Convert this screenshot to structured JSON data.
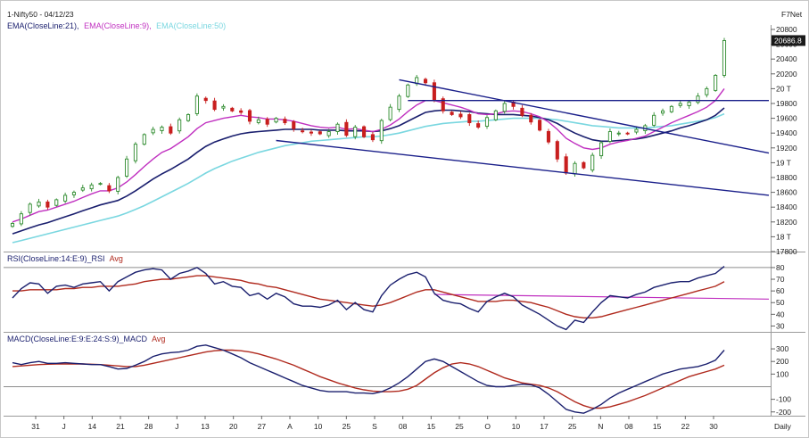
{
  "header": {
    "title": "1-Nifty50 - 04/12/23",
    "corner_label": "F7Net",
    "ema_legend": [
      {
        "text": "EMA(CloseLine:21),",
        "color": "#1a1f6e"
      },
      {
        "text": "EMA(CloseLine:9),",
        "color": "#c030c0"
      },
      {
        "text": "EMA(CloseLine:50)",
        "color": "#7ad7e0"
      }
    ]
  },
  "panels": {
    "rsi_title": "RSI(CloseLine:14:E:9)_RSI",
    "rsi_avg": "Avg",
    "macd_title": "MACD(CloseLine:E:9:E:24:S:9)_MACD",
    "macd_avg": "Avg",
    "footer_right": "Daily"
  },
  "colors": {
    "bull": "#2e8b2e",
    "bear": "#c81e1e",
    "ema9": "#c030c0",
    "ema21": "#1a1f6e",
    "ema50": "#7ad7e0",
    "trend": "#1a1f8a",
    "rsi_line": "#1a1f6e",
    "rsi_avg": "#b02a1e",
    "macd_line": "#1a1f6e",
    "macd_avg": "#b02a1e",
    "rsi_resist": "#c030c0"
  },
  "chart_data": [
    {
      "type": "candlestick",
      "title": "1-Nifty50 - 04/12/23",
      "series_names": [
        "EMA(CloseLine:21)",
        "EMA(CloseLine:9)",
        "EMA(CloseLine:50)"
      ],
      "y_ticks": [
        "20800",
        "20600",
        "20400",
        "20200",
        "20 T",
        "19800",
        "19600",
        "19400",
        "19200",
        "19 T",
        "18800",
        "18600",
        "18400",
        "18200",
        "18 T",
        "17800"
      ],
      "y_tick_values": [
        20800,
        20600,
        20400,
        20200,
        20000,
        19800,
        19600,
        19400,
        19200,
        19000,
        18800,
        18600,
        18400,
        18200,
        18000,
        17800
      ],
      "ylim": [
        17800,
        20800
      ],
      "last_price_label": "20686.8",
      "x_ticks": [
        "31",
        "J",
        "14",
        "21",
        "28",
        "J",
        "13",
        "20",
        "27",
        "A",
        "10",
        "25",
        "S",
        "08",
        "15",
        "25",
        "O",
        "10",
        "17",
        "25",
        "N",
        "08",
        "15",
        "22",
        "30"
      ],
      "close": [
        18180,
        18310,
        18440,
        18470,
        18400,
        18500,
        18560,
        18600,
        18660,
        18700,
        18720,
        18620,
        18800,
        19050,
        19250,
        19380,
        19450,
        19480,
        19400,
        19580,
        19650,
        19900,
        19840,
        19720,
        19760,
        19700,
        19680,
        19560,
        19580,
        19520,
        19600,
        19540,
        19460,
        19420,
        19400,
        19390,
        19420,
        19520,
        19370,
        19480,
        19350,
        19310,
        19570,
        19750,
        19900,
        20050,
        20150,
        20080,
        19840,
        19700,
        19650,
        19620,
        19540,
        19480,
        19610,
        19700,
        19800,
        19760,
        19640,
        19550,
        19440,
        19280,
        19050,
        18860,
        18990,
        18930,
        19100,
        19270,
        19420,
        19400,
        19390,
        19450,
        19500,
        19640,
        19700,
        19760,
        19800,
        19820,
        19900,
        20000,
        20180,
        20650
      ],
      "ema9": [
        18200,
        18240,
        18290,
        18340,
        18360,
        18400,
        18440,
        18480,
        18530,
        18580,
        18620,
        18620,
        18660,
        18740,
        18840,
        18950,
        19050,
        19140,
        19190,
        19270,
        19350,
        19460,
        19540,
        19570,
        19600,
        19620,
        19640,
        19620,
        19610,
        19590,
        19590,
        19580,
        19560,
        19530,
        19500,
        19480,
        19470,
        19480,
        19450,
        19460,
        19440,
        19420,
        19450,
        19510,
        19590,
        19690,
        19780,
        19840,
        19840,
        19810,
        19780,
        19750,
        19710,
        19660,
        19650,
        19660,
        19690,
        19700,
        19690,
        19660,
        19620,
        19550,
        19450,
        19330,
        19260,
        19200,
        19180,
        19200,
        19250,
        19280,
        19300,
        19330,
        19360,
        19420,
        19480,
        19540,
        19590,
        19640,
        19690,
        19750,
        19840,
        20000
      ],
      "ema21": [
        18040,
        18080,
        18120,
        18160,
        18190,
        18230,
        18270,
        18310,
        18350,
        18390,
        18430,
        18460,
        18490,
        18550,
        18620,
        18700,
        18780,
        18850,
        18910,
        18980,
        19050,
        19140,
        19220,
        19280,
        19320,
        19360,
        19390,
        19410,
        19420,
        19430,
        19440,
        19450,
        19450,
        19450,
        19450,
        19440,
        19440,
        19440,
        19430,
        19430,
        19430,
        19420,
        19430,
        19460,
        19500,
        19560,
        19620,
        19680,
        19700,
        19710,
        19710,
        19700,
        19690,
        19670,
        19660,
        19650,
        19650,
        19650,
        19640,
        19630,
        19610,
        19580,
        19530,
        19460,
        19400,
        19350,
        19310,
        19290,
        19290,
        19300,
        19310,
        19320,
        19340,
        19370,
        19400,
        19430,
        19470,
        19500,
        19540,
        19580,
        19640,
        19740
      ],
      "ema50": [
        17920,
        17950,
        17980,
        18010,
        18040,
        18070,
        18100,
        18130,
        18160,
        18190,
        18220,
        18250,
        18280,
        18320,
        18370,
        18420,
        18480,
        18540,
        18600,
        18660,
        18720,
        18790,
        18860,
        18920,
        18970,
        19020,
        19060,
        19100,
        19140,
        19170,
        19200,
        19230,
        19250,
        19270,
        19290,
        19300,
        19310,
        19320,
        19330,
        19340,
        19350,
        19350,
        19360,
        19380,
        19400,
        19430,
        19460,
        19490,
        19510,
        19530,
        19540,
        19550,
        19560,
        19560,
        19570,
        19580,
        19590,
        19600,
        19600,
        19600,
        19600,
        19590,
        19580,
        19560,
        19540,
        19520,
        19500,
        19490,
        19480,
        19470,
        19470,
        19470,
        19470,
        19480,
        19490,
        19500,
        19520,
        19540,
        19560,
        19580,
        19610,
        19660
      ]
    },
    {
      "type": "line",
      "title": "RSI(CloseLine:14:E:9)_RSI",
      "series_names": [
        "RSI",
        "Avg"
      ],
      "y_ticks": [
        "80",
        "70",
        "60",
        "50",
        "40",
        "30"
      ],
      "y_tick_values": [
        80,
        70,
        60,
        50,
        40,
        30
      ],
      "ylim": [
        25,
        83
      ],
      "rsi": [
        54,
        62,
        67,
        66,
        58,
        64,
        65,
        63,
        66,
        67,
        68,
        60,
        68,
        72,
        76,
        78,
        79,
        78,
        70,
        75,
        77,
        80,
        75,
        66,
        68,
        64,
        63,
        56,
        58,
        53,
        58,
        55,
        49,
        47,
        47,
        46,
        48,
        52,
        44,
        50,
        44,
        42,
        56,
        65,
        70,
        74,
        76,
        72,
        58,
        52,
        50,
        49,
        45,
        42,
        51,
        55,
        58,
        55,
        48,
        44,
        40,
        35,
        30,
        27,
        35,
        33,
        42,
        50,
        56,
        55,
        54,
        57,
        59,
        63,
        65,
        67,
        68,
        68,
        71,
        73,
        75,
        81
      ],
      "avg": [
        60,
        60,
        61,
        61,
        61,
        61,
        62,
        62,
        63,
        63,
        64,
        64,
        64,
        65,
        66,
        68,
        69,
        70,
        70,
        71,
        72,
        73,
        73,
        72,
        71,
        70,
        69,
        67,
        66,
        64,
        63,
        61,
        59,
        57,
        55,
        53,
        52,
        51,
        50,
        49,
        48,
        47,
        48,
        50,
        53,
        56,
        59,
        61,
        61,
        59,
        57,
        55,
        53,
        51,
        51,
        51,
        52,
        52,
        51,
        50,
        48,
        46,
        43,
        40,
        38,
        37,
        37,
        38,
        40,
        42,
        44,
        46,
        48,
        50,
        52,
        54,
        56,
        58,
        60,
        62,
        64,
        68
      ],
      "resistance_line": [
        57,
        53
      ]
    },
    {
      "type": "line",
      "title": "MACD(CloseLine:E:9:E:24:S:9)_MACD",
      "series_names": [
        "MACD",
        "Avg"
      ],
      "y_ticks": [
        "300",
        "200",
        "100",
        "-100",
        "-200"
      ],
      "y_tick_values": [
        300,
        200,
        100,
        -100,
        -200
      ],
      "ylim": [
        -230,
        350
      ],
      "macd": [
        190,
        175,
        190,
        200,
        185,
        185,
        190,
        185,
        180,
        175,
        175,
        160,
        140,
        145,
        170,
        200,
        240,
        260,
        270,
        275,
        290,
        320,
        330,
        310,
        290,
        260,
        230,
        190,
        160,
        130,
        100,
        70,
        40,
        10,
        -10,
        -30,
        -40,
        -40,
        -40,
        -50,
        -50,
        -55,
        -40,
        -10,
        30,
        80,
        140,
        200,
        220,
        200,
        160,
        120,
        80,
        40,
        10,
        0,
        0,
        10,
        20,
        15,
        -10,
        -60,
        -120,
        -180,
        -200,
        -210,
        -180,
        -140,
        -90,
        -50,
        -20,
        10,
        40,
        70,
        100,
        120,
        140,
        150,
        160,
        180,
        210,
        290
      ],
      "avg": [
        160,
        165,
        170,
        175,
        178,
        180,
        180,
        180,
        180,
        178,
        175,
        170,
        165,
        160,
        160,
        170,
        185,
        200,
        215,
        230,
        245,
        260,
        275,
        285,
        290,
        290,
        285,
        275,
        260,
        240,
        220,
        195,
        170,
        140,
        110,
        80,
        55,
        30,
        10,
        -10,
        -25,
        -35,
        -40,
        -40,
        -35,
        -20,
        10,
        60,
        110,
        150,
        180,
        190,
        180,
        160,
        130,
        100,
        70,
        50,
        30,
        20,
        10,
        -10,
        -40,
        -80,
        -120,
        -150,
        -170,
        -170,
        -160,
        -140,
        -120,
        -95,
        -70,
        -40,
        -10,
        20,
        50,
        80,
        100,
        120,
        140,
        170
      ]
    }
  ]
}
